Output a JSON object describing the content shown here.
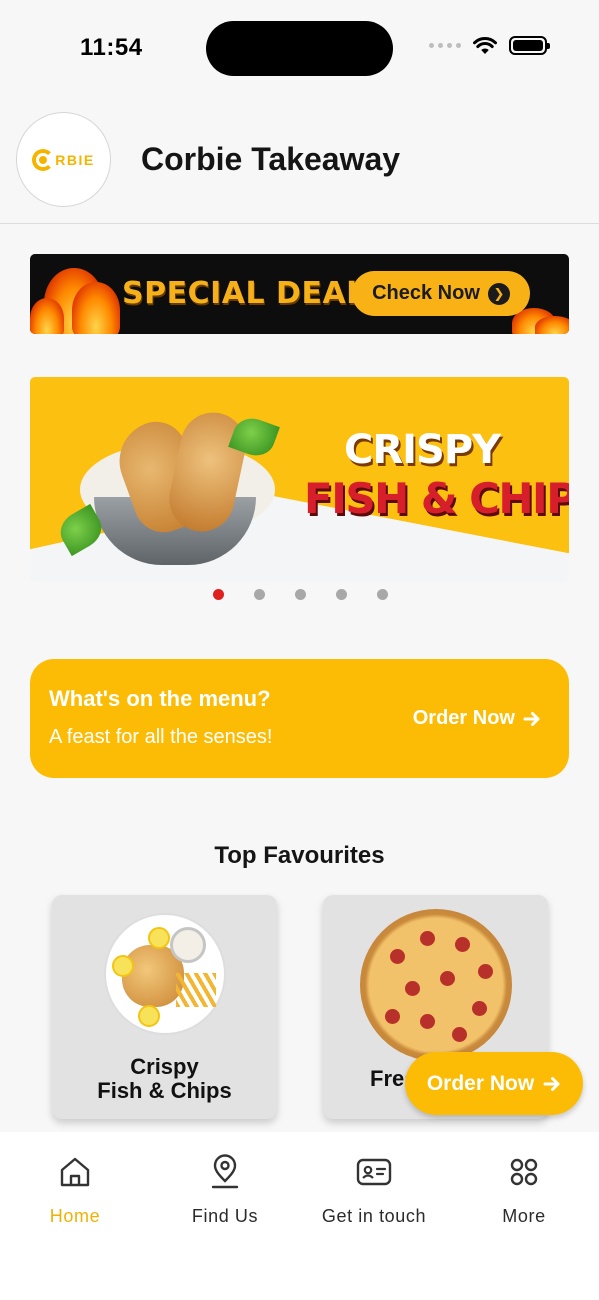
{
  "status_bar": {
    "time": "11:54"
  },
  "header": {
    "logo_text": "RBIE",
    "title": "Corbie Takeaway"
  },
  "deals_banner": {
    "text": "SPECIAL DEALS",
    "button_label": "Check Now"
  },
  "hero": {
    "line1": "CRISPY",
    "line2": "FISH & CHIPS",
    "slide_count": 5,
    "active_slide": 1
  },
  "menu_card": {
    "heading": "What's on the menu?",
    "subheading": "A feast for all the senses!",
    "action_label": "Order Now"
  },
  "favourites": {
    "title": "Top Favourites",
    "items": [
      {
        "name_line1": "Crispy",
        "name_line2": "Fish & Chips"
      },
      {
        "name_line1": "Fres",
        "name_line2": ""
      }
    ]
  },
  "fab": {
    "label": "Order Now"
  },
  "tab_bar": {
    "items": [
      {
        "label": "Home",
        "icon": "home-icon",
        "active": true
      },
      {
        "label": "Find Us",
        "icon": "location-pin-icon",
        "active": false
      },
      {
        "label": "Get in touch",
        "icon": "contact-card-icon",
        "active": false
      },
      {
        "label": "More",
        "icon": "grid-dots-icon",
        "active": false
      }
    ]
  },
  "colors": {
    "accent": "#fcbc05",
    "active_tab": "#f2b005",
    "pager_active": "#e0201d"
  }
}
